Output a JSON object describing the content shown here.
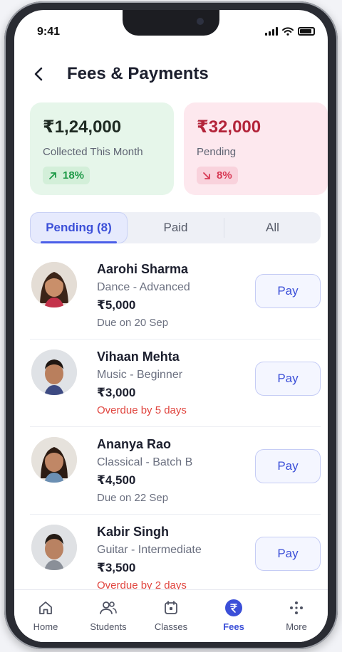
{
  "status_bar": {
    "time": "9:41"
  },
  "header": {
    "title": "Fees & Payments"
  },
  "stats": [
    {
      "amount": "₹1,24,000",
      "label": "Collected This Month",
      "change": "18%",
      "trend": "up"
    },
    {
      "amount": "₹32,000",
      "label": "Pending",
      "change": "8%",
      "trend": "down"
    }
  ],
  "tabs": [
    {
      "label": "Pending (8)",
      "active": true
    },
    {
      "label": "Paid",
      "active": false
    },
    {
      "label": "All",
      "active": false
    }
  ],
  "students": [
    {
      "name": "Aarohi Sharma",
      "course": "Dance - Advanced",
      "amount": "₹5,000",
      "due": "Due on 20 Sep",
      "overdue": false,
      "action": "Pay"
    },
    {
      "name": "Vihaan Mehta",
      "course": "Music - Beginner",
      "amount": "₹3,000",
      "due": "Overdue by 5 days",
      "overdue": true,
      "action": "Pay"
    },
    {
      "name": "Ananya Rao",
      "course": "Classical - Batch B",
      "amount": "₹4,500",
      "due": "Due on 22 Sep",
      "overdue": false,
      "action": "Pay"
    },
    {
      "name": "Kabir Singh",
      "course": "Guitar - Intermediate",
      "amount": "₹3,500",
      "due": "Overdue by 2 days",
      "overdue": true,
      "action": "Pay"
    }
  ],
  "bottom_nav": [
    {
      "label": "Home",
      "icon": "home-icon",
      "active": false
    },
    {
      "label": "Students",
      "icon": "users-icon",
      "active": false
    },
    {
      "label": "Classes",
      "icon": "calendar-icon",
      "active": false
    },
    {
      "label": "Fees",
      "icon": "rupee-icon",
      "active": true
    },
    {
      "label": "More",
      "icon": "grid-icon",
      "active": false
    }
  ],
  "colors": {
    "accent": "#3b4fd8",
    "positive": "#1f9a48",
    "negative": "#d83a55",
    "overdue": "#e0453f"
  }
}
